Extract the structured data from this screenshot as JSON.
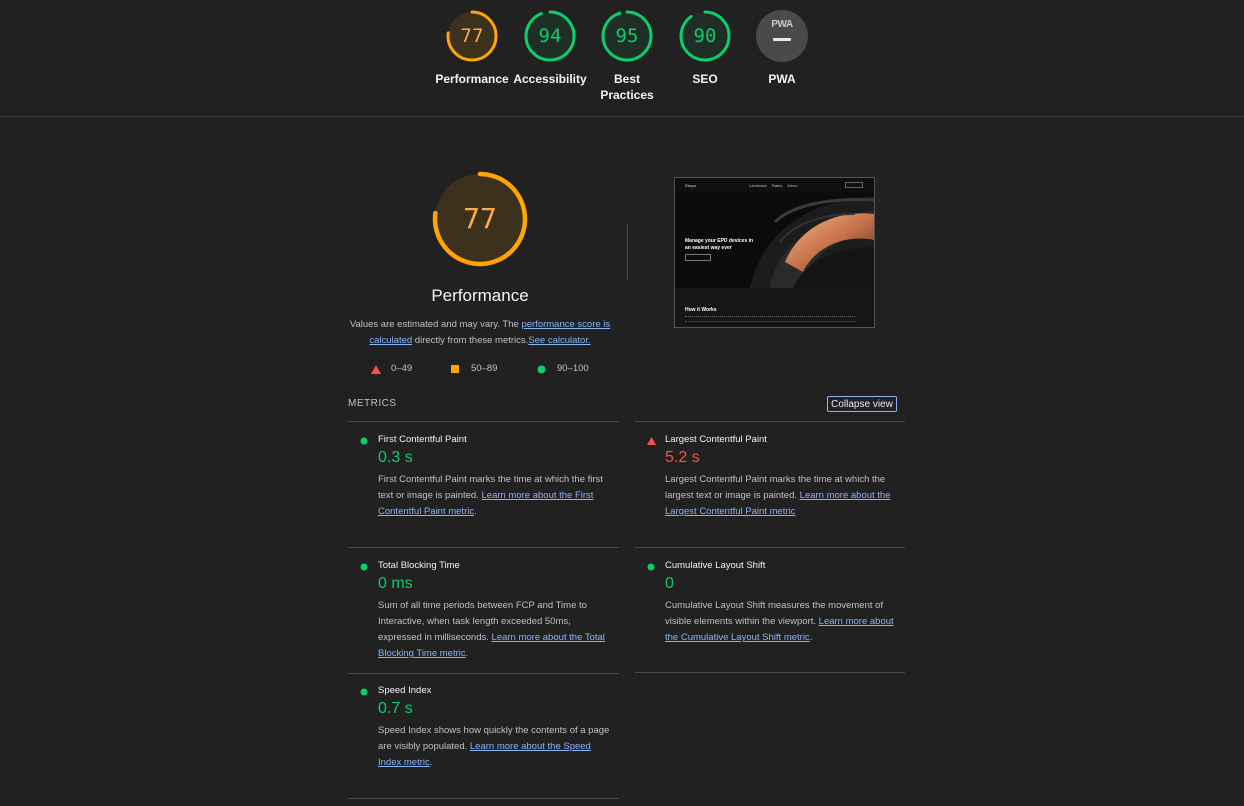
{
  "colors": {
    "pass": "#0cce6b",
    "average": "#ffa400",
    "fail": "#ff4e42",
    "link": "#8ab4f8",
    "background": "#212121"
  },
  "gauges": [
    {
      "score": "77",
      "label": "Performance",
      "color": "#ffa400",
      "value": 0.77
    },
    {
      "score": "94",
      "label": "Accessibility",
      "color": "#0cce6b",
      "value": 0.94
    },
    {
      "score": "95",
      "label": "Best Practices",
      "color": "#0cce6b",
      "value": 0.95
    },
    {
      "score": "90",
      "label": "SEO",
      "color": "#0cce6b",
      "value": 0.9
    }
  ],
  "pwa": {
    "badge_text": "PWA",
    "label": "PWA"
  },
  "performance": {
    "score": "77",
    "title": "Performance",
    "desc_prefix": "Values are estimated and may vary. The ",
    "desc_link1": "performance score is calculated",
    "desc_middle": " directly from these metrics.",
    "desc_link2": "See calculator."
  },
  "legend": [
    {
      "range": "0–49",
      "icon": "triangle-icon"
    },
    {
      "range": "50–89",
      "icon": "square-icon"
    },
    {
      "range": "90–100",
      "icon": "circle-icon"
    }
  ],
  "screenshot": {
    "brand": "Ekspo",
    "nav": "Landmark  Rates  Menu",
    "hero_title": "Manage your EPD devices in an easiest way ever",
    "section_title": "How it Works"
  },
  "metrics_section": {
    "heading": "METRICS",
    "collapse_label": "Collapse view"
  },
  "metrics": [
    {
      "title": "First Contentful Paint",
      "value": "0.3 s",
      "status": "pass",
      "desc": "First Contentful Paint marks the time at which the first text or image is painted. ",
      "link": "Learn more about the First Contentful Paint metric",
      "after": "."
    },
    {
      "title": "Largest Contentful Paint",
      "value": "5.2 s",
      "status": "fail",
      "desc": "Largest Contentful Paint marks the time at which the largest text or image is painted. ",
      "link": "Learn more about the Largest Contentful Paint metric",
      "after": ""
    },
    {
      "title": "Total Blocking Time",
      "value": "0 ms",
      "status": "pass",
      "desc": "Sum of all time periods between FCP and Time to Interactive, when task length exceeded 50ms, expressed in milliseconds. ",
      "link": "Learn more about the Total Blocking Time metric",
      "after": "."
    },
    {
      "title": "Cumulative Layout Shift",
      "value": "0",
      "status": "pass",
      "desc": "Cumulative Layout Shift measures the movement of visible elements within the viewport. ",
      "link": "Learn more about the Cumulative Layout Shift metric",
      "after": "."
    },
    {
      "title": "Speed Index",
      "value": "0.7 s",
      "status": "pass",
      "desc": "Speed Index shows how quickly the contents of a page are visibly populated. ",
      "link": "Learn more about the Speed Index metric",
      "after": "."
    }
  ]
}
